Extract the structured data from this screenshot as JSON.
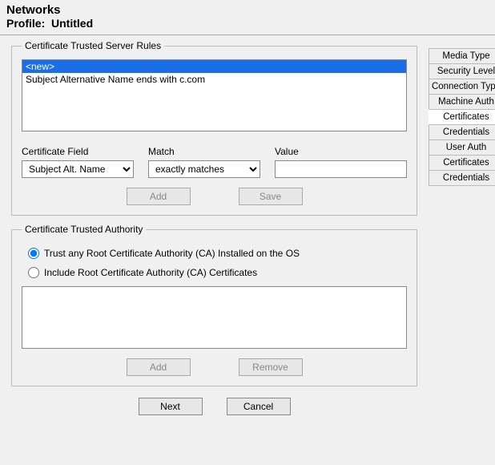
{
  "header": {
    "title": "Networks",
    "profile_label": "Profile:",
    "profile_name": "Untitled"
  },
  "tabs": {
    "items": [
      {
        "label": "Media Type",
        "active": false
      },
      {
        "label": "Security Level",
        "active": false
      },
      {
        "label": "Connection Type",
        "active": false
      },
      {
        "label": "Machine Auth",
        "active": false
      },
      {
        "label": "Certificates",
        "active": true
      },
      {
        "label": "Credentials",
        "active": false
      },
      {
        "label": "User Auth",
        "active": false
      },
      {
        "label": "Certificates",
        "active": false
      },
      {
        "label": "Credentials",
        "active": false
      }
    ]
  },
  "rules_group": {
    "legend": "Certificate Trusted Server Rules",
    "list_items": [
      {
        "text": "<new>",
        "selected": true
      },
      {
        "text": "Subject Alternative Name ends with c.com",
        "selected": false
      }
    ],
    "field_labels": {
      "cert_field": "Certificate Field",
      "match": "Match",
      "value": "Value"
    },
    "cert_field_options": [
      "Subject Alt. Name"
    ],
    "cert_field_value": "Subject Alt. Name",
    "match_options": [
      "exactly matches"
    ],
    "match_value": "exactly matches",
    "value_input": "",
    "buttons": {
      "add": "Add",
      "save": "Save"
    }
  },
  "authority_group": {
    "legend": "Certificate Trusted Authority",
    "radio_trust_any": "Trust any Root Certificate Authority (CA) Installed on the OS",
    "radio_include": "Include Root Certificate Authority (CA) Certificates",
    "selected_radio": "trust_any",
    "buttons": {
      "add": "Add",
      "remove": "Remove"
    }
  },
  "footer": {
    "next": "Next",
    "cancel": "Cancel"
  }
}
